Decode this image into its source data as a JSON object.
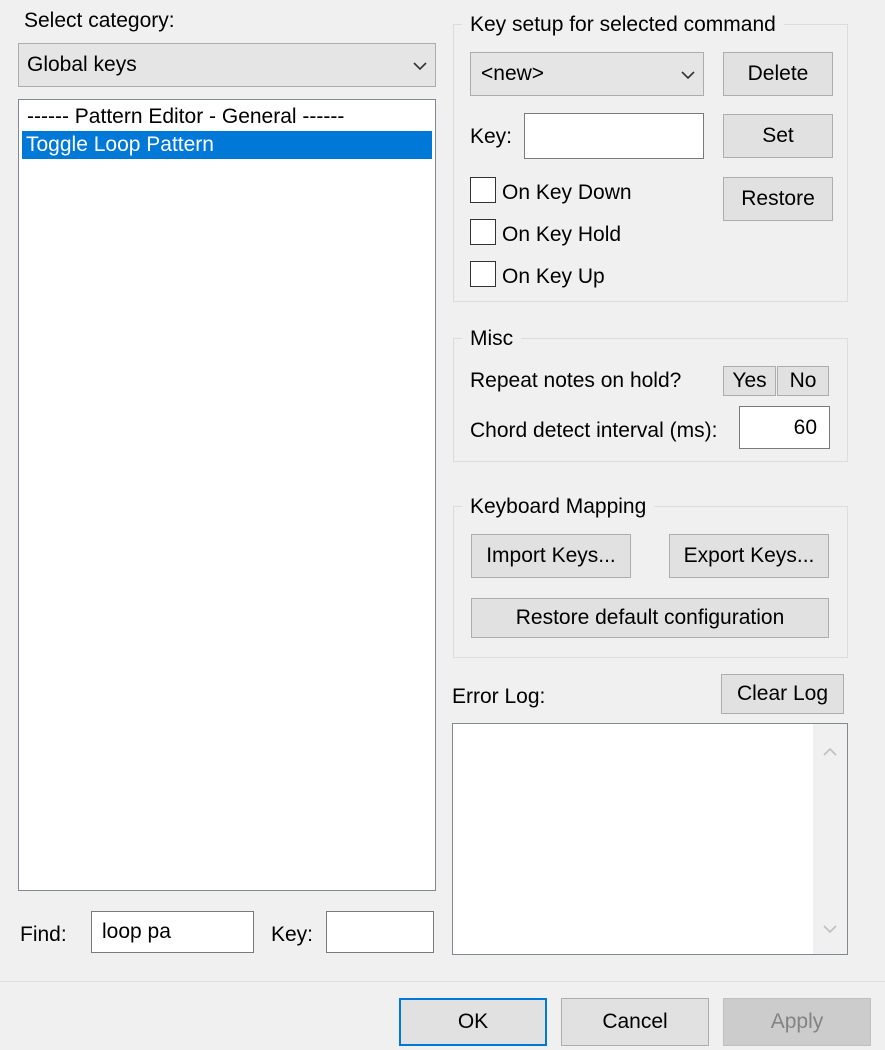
{
  "category": {
    "label": "Select category:",
    "selected": "Global keys"
  },
  "command_list": {
    "items": [
      {
        "label": "------ Pattern Editor - General ------",
        "selected": false
      },
      {
        "label": "Toggle Loop Pattern",
        "selected": true
      }
    ]
  },
  "find": {
    "label": "Find:",
    "value": "loop pa",
    "key_label": "Key:",
    "key_value": ""
  },
  "key_setup": {
    "title": "Key setup for selected command",
    "combo_value": "<new>",
    "delete_label": "Delete",
    "key_label": "Key:",
    "key_value": "",
    "set_label": "Set",
    "restore_label": "Restore",
    "on_key_down": {
      "label": "On Key Down",
      "checked": false
    },
    "on_key_hold": {
      "label": "On Key Hold",
      "checked": false
    },
    "on_key_up": {
      "label": "On Key Up",
      "checked": false
    }
  },
  "misc": {
    "title": "Misc",
    "repeat_label": "Repeat notes on hold?",
    "yes_label": "Yes",
    "no_label": "No",
    "chord_label": "Chord detect interval (ms):",
    "chord_value": "60"
  },
  "keyboard_mapping": {
    "title": "Keyboard Mapping",
    "import_label": "Import Keys...",
    "export_label": "Export Keys...",
    "restore_default_label": "Restore default configuration"
  },
  "error_log": {
    "label": "Error Log:",
    "clear_label": "Clear Log",
    "content": ""
  },
  "footer": {
    "ok_label": "OK",
    "cancel_label": "Cancel",
    "apply_label": "Apply"
  },
  "colors": {
    "selection": "#0078d7",
    "window_bg": "#f0f0f0",
    "button_bg": "#e1e1e1",
    "disabled_text": "#838383"
  }
}
